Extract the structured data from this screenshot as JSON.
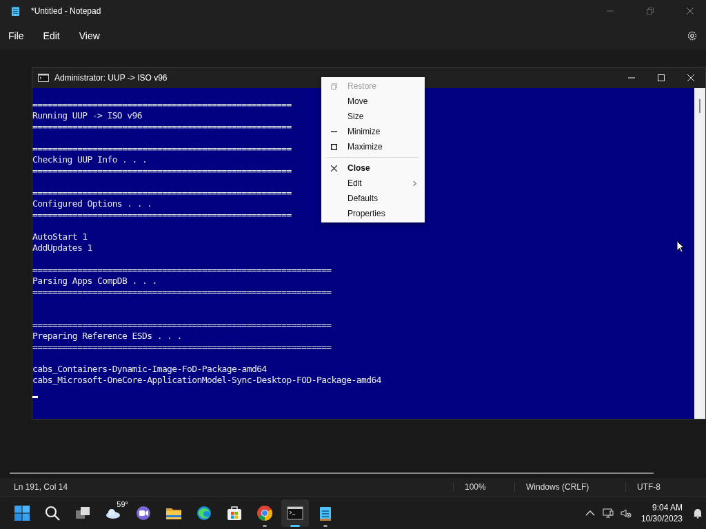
{
  "notepad": {
    "title": "*Untitled - Notepad",
    "menu": [
      "File",
      "Edit",
      "View"
    ],
    "status": {
      "position": "Ln 191, Col 14",
      "zoom": "100%",
      "line_ending": "Windows (CRLF)",
      "encoding": "UTF-8"
    }
  },
  "console": {
    "title": "Administrator:  UUP -> ISO v96",
    "lines": [
      {
        "kind": "text",
        "text": "===================================================="
      },
      {
        "kind": "text",
        "text": "Running UUP -> ISO v96"
      },
      {
        "kind": "text",
        "text": "===================================================="
      },
      {
        "kind": "blank"
      },
      {
        "kind": "text",
        "text": "===================================================="
      },
      {
        "kind": "text",
        "text": "Checking UUP Info . . ."
      },
      {
        "kind": "text",
        "text": "===================================================="
      },
      {
        "kind": "blank"
      },
      {
        "kind": "text",
        "text": "===================================================="
      },
      {
        "kind": "text",
        "text": "Configured Options . . ."
      },
      {
        "kind": "text",
        "text": "===================================================="
      },
      {
        "kind": "blank"
      },
      {
        "kind": "text",
        "text": "AutoStart 1"
      },
      {
        "kind": "text",
        "text": "AddUpdates 1"
      },
      {
        "kind": "blank"
      },
      {
        "kind": "text",
        "text": "============================================================"
      },
      {
        "kind": "text",
        "text": "Parsing Apps CompDB . . ."
      },
      {
        "kind": "text",
        "text": "============================================================"
      },
      {
        "kind": "blank"
      },
      {
        "kind": "blank"
      },
      {
        "kind": "text",
        "text": "============================================================"
      },
      {
        "kind": "text",
        "text": "Preparing Reference ESDs . . ."
      },
      {
        "kind": "text",
        "text": "============================================================"
      },
      {
        "kind": "blank"
      },
      {
        "kind": "text",
        "text": "cabs_Containers-Dynamic-Image-FoD-Package-amd64"
      },
      {
        "kind": "text",
        "text": "cabs_Microsoft-OneCore-ApplicationModel-Sync-Desktop-FOD-Package-amd64"
      },
      {
        "kind": "cursor"
      }
    ]
  },
  "context_menu": [
    {
      "kind": "restore",
      "label": "Restore",
      "disabled": true
    },
    {
      "kind": "plain",
      "label": "Move",
      "disabled": false
    },
    {
      "kind": "plain",
      "label": "Size",
      "disabled": false
    },
    {
      "kind": "minimize",
      "label": "Minimize",
      "disabled": false
    },
    {
      "kind": "maximize",
      "label": "Maximize",
      "disabled": false
    },
    {
      "kind": "separator"
    },
    {
      "kind": "close",
      "label": "Close",
      "disabled": false
    },
    {
      "kind": "submenu",
      "label": "Edit",
      "disabled": false
    },
    {
      "kind": "plain",
      "label": "Defaults",
      "disabled": false
    },
    {
      "kind": "plain",
      "label": "Properties",
      "disabled": false
    }
  ],
  "taskbar": {
    "apps": [
      {
        "kind": "start",
        "selected": false,
        "running": false
      },
      {
        "kind": "search",
        "selected": false,
        "running": false
      },
      {
        "kind": "taskview",
        "selected": false,
        "running": false
      },
      {
        "kind": "weather",
        "label": "59°",
        "selected": false,
        "running": false
      },
      {
        "kind": "chat",
        "selected": false,
        "running": false
      },
      {
        "kind": "folder",
        "selected": false,
        "running": false
      },
      {
        "kind": "browser",
        "selected": false,
        "running": false
      },
      {
        "kind": "store",
        "selected": false,
        "running": false
      },
      {
        "kind": "chrome",
        "selected": false,
        "running": true
      },
      {
        "kind": "terminal",
        "selected": true,
        "running": true
      },
      {
        "kind": "notepad",
        "selected": false,
        "running": true
      }
    ],
    "time": "9:04 AM",
    "date": "10/30/2023"
  }
}
